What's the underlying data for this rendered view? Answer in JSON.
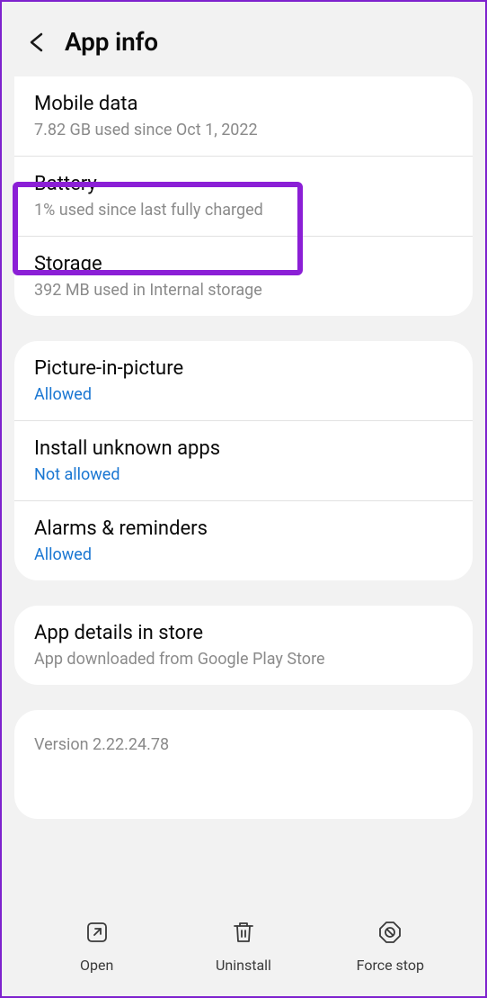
{
  "header": {
    "title": "App info"
  },
  "usage": {
    "mobile_data": {
      "title": "Mobile data",
      "sub": "7.82 GB used since Oct 1, 2022"
    },
    "battery": {
      "title": "Battery",
      "sub": "1% used since last fully charged"
    },
    "storage": {
      "title": "Storage",
      "sub": "392 MB used in Internal storage"
    }
  },
  "permissions": {
    "pip": {
      "title": "Picture-in-picture",
      "status": "Allowed"
    },
    "unknown_apps": {
      "title": "Install unknown apps",
      "status": "Not allowed"
    },
    "alarms": {
      "title": "Alarms & reminders",
      "status": "Allowed"
    }
  },
  "store": {
    "title": "App details in store",
    "sub": "App downloaded from Google Play Store"
  },
  "version": {
    "text": "Version 2.22.24.78"
  },
  "bottom": {
    "open": "Open",
    "uninstall": "Uninstall",
    "force_stop": "Force stop"
  },
  "highlight": {
    "target": "battery"
  }
}
